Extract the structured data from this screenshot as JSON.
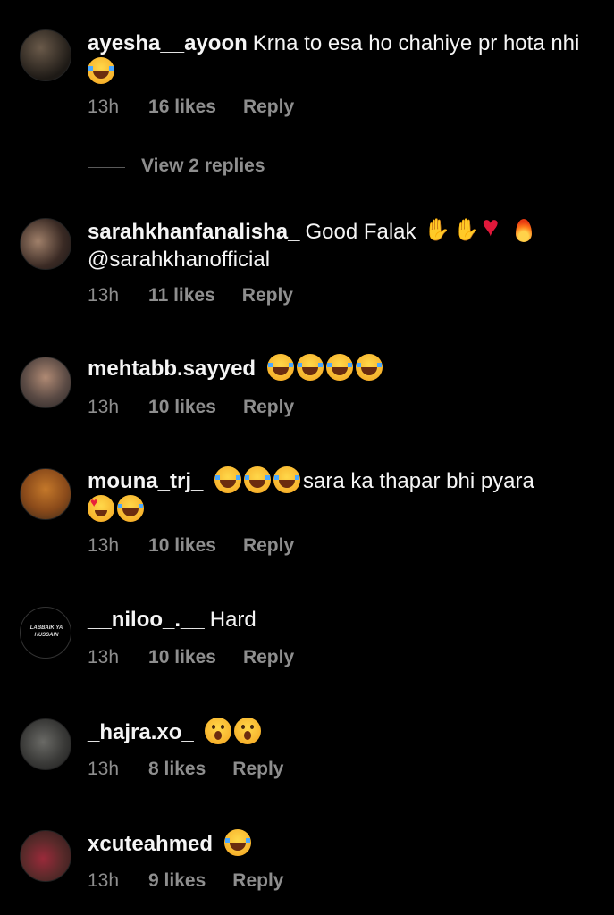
{
  "colors": {
    "background": "#000000",
    "text": "#f5f5f5",
    "muted": "#8e8e8e"
  },
  "comments": [
    {
      "username": "ayesha__ayoon",
      "text": "Krna to esa ho chahiye pr hota nhi",
      "emojis": [
        "laugh-emoji"
      ],
      "time": "13h",
      "likes": "16 likes",
      "reply": "Reply",
      "view_replies": "View 2 replies"
    },
    {
      "username": "sarahkhanfanalisha_",
      "text": "Good Falak",
      "emojis": [
        "clap-emoji",
        "raised-hands-emoji",
        "heart-emoji",
        "fire-emoji"
      ],
      "mention": "@sarahkhanofficial",
      "time": "13h",
      "likes": "11 likes",
      "reply": "Reply"
    },
    {
      "username": "mehtabb.sayyed",
      "text": "",
      "emojis": [
        "laugh-emoji",
        "laugh-emoji",
        "laugh-emoji",
        "laugh-emoji"
      ],
      "time": "13h",
      "likes": "10 likes",
      "reply": "Reply"
    },
    {
      "username": "mouna_trj_",
      "text": "sara ka thapar bhi pyara",
      "emojis": [
        "laugh-emoji",
        "laugh-emoji",
        "laugh-emoji"
      ],
      "emojis_after": [
        "heart-eyes-emoji",
        "laugh-emoji"
      ],
      "time": "13h",
      "likes": "10 likes",
      "reply": "Reply"
    },
    {
      "username": "__niloo_.__",
      "text": "Hard",
      "avatar_text": "LABBAIK YA HUSSAIN",
      "time": "13h",
      "likes": "10 likes",
      "reply": "Reply"
    },
    {
      "username": "_hajra.xo_",
      "text": "",
      "emojis": [
        "surprised-emoji",
        "surprised-emoji"
      ],
      "time": "13h",
      "likes": "8 likes",
      "reply": "Reply"
    },
    {
      "username": "xcuteahmed",
      "text": "",
      "emojis": [
        "laugh-emoji"
      ],
      "time": "13h",
      "likes": "9 likes",
      "reply": "Reply"
    }
  ]
}
